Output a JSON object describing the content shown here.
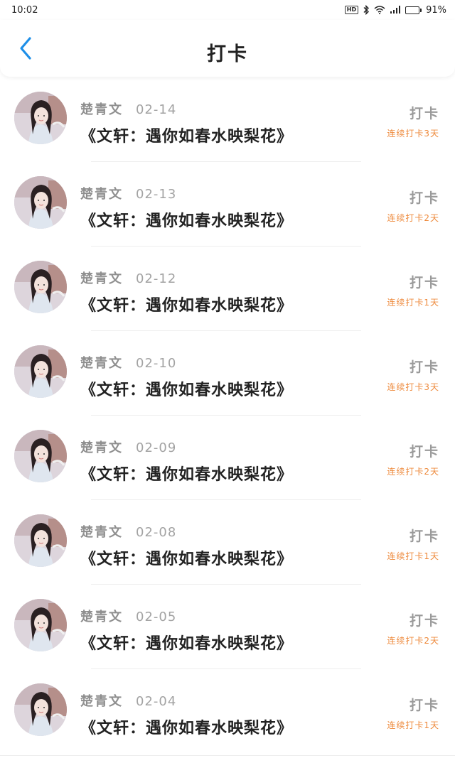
{
  "status_bar": {
    "time": "10:02",
    "hd": "HD",
    "battery_percent": "91%",
    "battery_level": 0.91
  },
  "header": {
    "title": "打卡"
  },
  "colors": {
    "accent_blue": "#1e8fe8",
    "streak_orange": "#ee8a3c"
  },
  "records": [
    {
      "name": "楚青文",
      "date": "02-14",
      "content": "《文轩：遇你如春水映梨花》",
      "action": "打卡",
      "streak": "连续打卡3天"
    },
    {
      "name": "楚青文",
      "date": "02-13",
      "content": "《文轩：遇你如春水映梨花》",
      "action": "打卡",
      "streak": "连续打卡2天"
    },
    {
      "name": "楚青文",
      "date": "02-12",
      "content": "《文轩：遇你如春水映梨花》",
      "action": "打卡",
      "streak": "连续打卡1天"
    },
    {
      "name": "楚青文",
      "date": "02-10",
      "content": "《文轩：遇你如春水映梨花》",
      "action": "打卡",
      "streak": "连续打卡3天"
    },
    {
      "name": "楚青文",
      "date": "02-09",
      "content": "《文轩：遇你如春水映梨花》",
      "action": "打卡",
      "streak": "连续打卡2天"
    },
    {
      "name": "楚青文",
      "date": "02-08",
      "content": "《文轩：遇你如春水映梨花》",
      "action": "打卡",
      "streak": "连续打卡1天"
    },
    {
      "name": "楚青文",
      "date": "02-05",
      "content": "《文轩：遇你如春水映梨花》",
      "action": "打卡",
      "streak": "连续打卡2天"
    },
    {
      "name": "楚青文",
      "date": "02-04",
      "content": "《文轩：遇你如春水映梨花》",
      "action": "打卡",
      "streak": "连续打卡1天"
    }
  ]
}
